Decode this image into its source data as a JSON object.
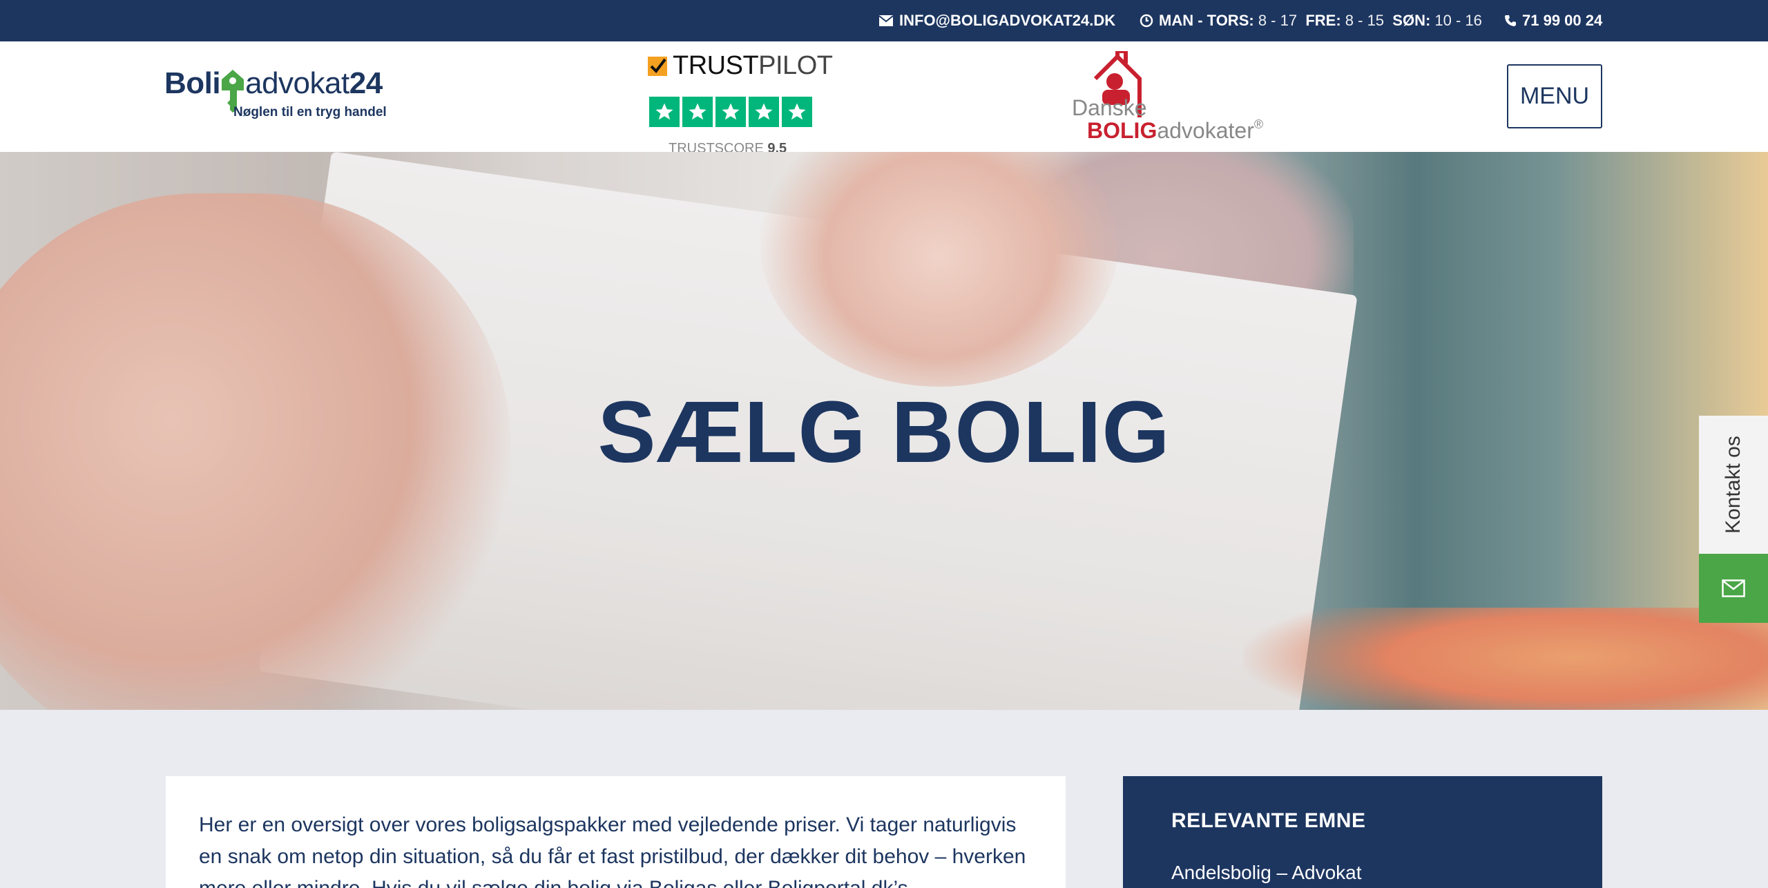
{
  "topbar": {
    "email": "INFO@BOLIGADVOKAT24.DK",
    "hours_label_1": "MAN - TORS:",
    "hours_value_1": "8 - 17",
    "hours_label_2": "FRE:",
    "hours_value_2": "8 - 15",
    "hours_label_3": "SØN:",
    "hours_value_3": "10 - 16",
    "phone": "71 99 00 24"
  },
  "header": {
    "logo": {
      "word_bold": "Boli",
      "word_thin": "advokat",
      "word_num": "24",
      "tagline": "Nøglen til en tryg handel"
    },
    "trustpilot": {
      "title_bold": "TRUST",
      "title_light": "PILOT",
      "score_label": "TRUSTSCORE",
      "score_value": "9.5",
      "stars": 5
    },
    "danske": {
      "line1": "Danske",
      "line2_red": "BOLIG",
      "line2_gray": "advokater",
      "reg": "®"
    },
    "menu_label": "MENU"
  },
  "hero": {
    "title": "SÆLG BOLIG"
  },
  "side": {
    "contact_label": "Kontakt os"
  },
  "content": {
    "intro": "Her er en oversigt over vores boligsalgspakker med vejledende priser. Vi tager naturligvis en snak om netop din situation, så du får et fast pristilbud, der dækker dit behov – hverken mere eller mindre. Hvis du vil sælge din bolig via Boligas eller Boligportal.dk’s"
  },
  "sidebar": {
    "heading": "RELEVANTE EMNE",
    "links": [
      "Andelsbolig – Advokat"
    ]
  },
  "colors": {
    "navy": "#1d3660",
    "trust_green": "#00b67a",
    "mail_green": "#4aa646",
    "danske_red": "#c8202f"
  }
}
